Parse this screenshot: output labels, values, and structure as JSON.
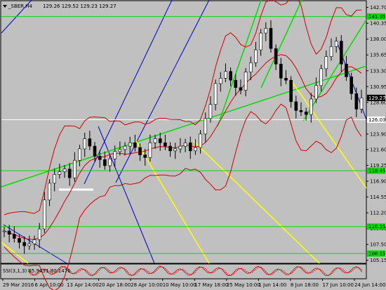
{
  "header": {
    "symbol_label": "_SBER,H4",
    "ohlc": "129.26 129.52 129.23 129.27"
  },
  "indicator": {
    "label": "SSI(3,1,3) 85.9431 80.1476"
  },
  "colors": {
    "background": "#c0c0c0",
    "bollinger": "#d40000",
    "trend_green": "#00dd00",
    "trend_yellow": "#ffff00",
    "trend_blue": "#0000cc",
    "hline_green": "#00dd00",
    "hline_white": "#ffffff",
    "candle": "#000000"
  },
  "chart_data": {
    "type": "candlestick",
    "title": "_SBER,H4",
    "ylim": [
      104.8,
      143.6
    ],
    "y_ticks": [
      142.7,
      140.35,
      138.0,
      135.65,
      133.3,
      130.95,
      128.6,
      126.25,
      123.9,
      121.6,
      119.25,
      116.9,
      114.55,
      112.2,
      109.85,
      107.5,
      105.15
    ],
    "x_ticks": [
      "29 Mar 2016",
      "6 Apr 10:00",
      "13 Apr 14:00",
      "20 Apr 18:00",
      "28 Apr 10:00",
      "10 May 10:00",
      "17 May 18:00",
      "25 May 10:00",
      "1 Jun 14:00",
      "8 Jun 18:00",
      "17 Jun 10:00",
      "24 Jun 14:00"
    ],
    "price_labels": [
      {
        "value": 141.35,
        "text": "141.35",
        "color": "#00dd00"
      },
      {
        "value": 129.27,
        "text": "129.27",
        "color": "#000000",
        "text_color": "#ffffff"
      },
      {
        "value": 126.03,
        "text": "126.03",
        "color": "#ffffff",
        "text_color": "#000000"
      },
      {
        "value": 118.45,
        "text": "118.45",
        "color": "#00dd00"
      },
      {
        "value": 110.15,
        "text": "110.15",
        "color": "#00dd00"
      },
      {
        "value": 106.15,
        "text": "106.15",
        "color": "#00dd00"
      }
    ],
    "horizontal_lines": [
      {
        "value": 141.35,
        "color": "#00dd00"
      },
      {
        "value": 126.03,
        "color": "#ffffff"
      },
      {
        "value": 118.45,
        "color": "#00dd00"
      },
      {
        "value": 110.15,
        "color": "#00dd00"
      },
      {
        "value": 106.15,
        "color": "#00dd00"
      }
    ],
    "close_series": [
      109.5,
      109.0,
      108.4,
      107.8,
      107.3,
      107.6,
      108.2,
      109.8,
      114.1,
      116.6,
      117.9,
      118.3,
      118.7,
      117.4,
      120.0,
      121.7,
      123.2,
      122.1,
      120.6,
      120.1,
      119.2,
      120.2,
      121.3,
      121.6,
      122.1,
      122.6,
      121.9,
      120.8,
      120.4,
      122.6,
      123.2,
      122.6,
      122.1,
      121.4,
      121.7,
      122.1,
      122.6,
      121.4,
      121.9,
      123.9,
      126.2,
      128.3,
      131.4,
      132.2,
      133.2,
      131.9,
      130.8,
      130.4,
      133.1,
      134.5,
      136.4,
      138.9,
      139.6,
      136.6,
      134.3,
      132.2,
      131.9,
      128.7,
      127.4,
      127.2,
      126.8,
      129.1,
      131.1,
      133.6,
      135.4,
      136.9,
      137.7,
      134.3,
      132.4,
      129.9,
      127.6,
      129.27
    ]
  }
}
